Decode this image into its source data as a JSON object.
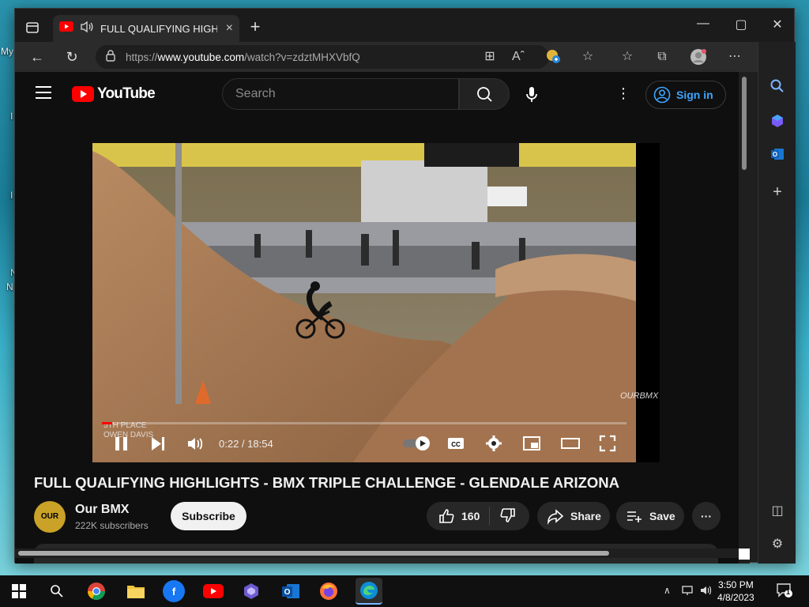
{
  "desktop": {
    "fragments": [
      "My",
      "I",
      "I",
      "N",
      "N"
    ]
  },
  "browser": {
    "tab": {
      "title": "FULL QUALIFYING HIGHLIGI",
      "close": "×"
    },
    "new_tab": "+",
    "url": {
      "prefix": "https://",
      "host": "www.youtube.com",
      "path": "/watch?v=zdztMHXVbfQ"
    }
  },
  "youtube": {
    "logo_text": "YouTube",
    "search_placeholder": "Search",
    "sign_in": "Sign in",
    "player": {
      "time": "0:22 / 18:54",
      "progress": 0.02,
      "caption_line1": "5TH PLACE",
      "caption_line2": "OWEN DAVIS",
      "watermark": "OURBMX"
    },
    "video_title": "FULL QUALIFYING HIGHLIGHTS - BMX TRIPLE CHALLENGE - GLENDALE ARIZONA",
    "channel": {
      "avatar_text": "OUR BMX",
      "name": "Our BMX",
      "subscribers": "222K subscribers",
      "subscribe_label": "Subscribe"
    },
    "actions": {
      "like_count": "160",
      "share": "Share",
      "save": "Save",
      "more": "···"
    }
  },
  "taskbar": {
    "time": "3:50 PM",
    "date": "4/8/2023",
    "notifications": "1"
  }
}
